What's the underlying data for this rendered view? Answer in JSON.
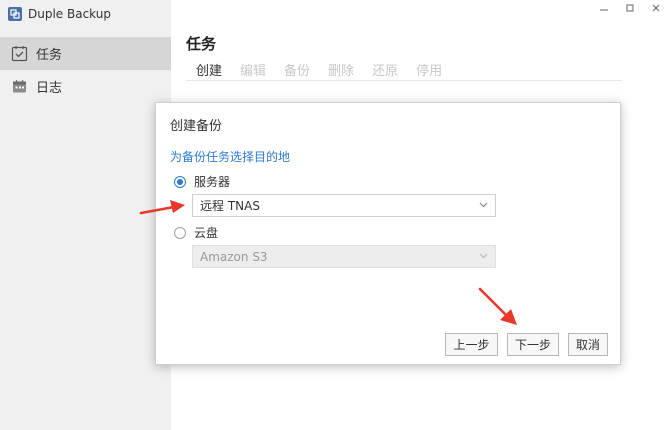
{
  "app": {
    "title": "Duple Backup"
  },
  "sidebar": {
    "items": [
      {
        "label": "任务",
        "icon": "calendar-check-icon",
        "active": true
      },
      {
        "label": "日志",
        "icon": "calendar-icon",
        "active": false
      }
    ]
  },
  "main": {
    "title": "任务",
    "toolbar": {
      "create": "创建",
      "edit": "编辑",
      "backup": "备份",
      "delete": "删除",
      "restore": "还原",
      "disable": "停用"
    }
  },
  "dialog": {
    "title": "创建备份",
    "subtitle": "为备份任务选择目的地",
    "server_option": {
      "label": "服务器",
      "selected": true,
      "value": "远程 TNAS"
    },
    "cloud_option": {
      "label": "云盘",
      "selected": false,
      "value": "Amazon S3"
    },
    "buttons": {
      "prev": "上一步",
      "next": "下一步",
      "cancel": "取消"
    }
  },
  "colors": {
    "accent": "#2e7bcf",
    "sidebar_bg": "#f0f0f0",
    "active_item_bg": "#d6d6d6",
    "annotation_arrow": "#e8382c"
  }
}
